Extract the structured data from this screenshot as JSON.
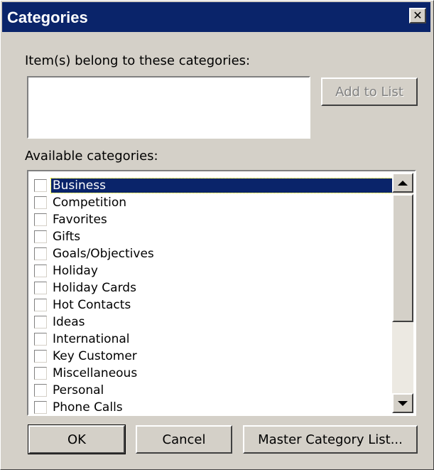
{
  "window": {
    "title": "Categories",
    "close_glyph": "✕"
  },
  "assigned": {
    "label": "Item(s) belong to these categories:",
    "value": "",
    "add_button": "Add to List"
  },
  "available": {
    "label": "Available categories:",
    "selected": "Business",
    "items": [
      {
        "label": "Business",
        "checked": false
      },
      {
        "label": "Competition",
        "checked": false
      },
      {
        "label": "Favorites",
        "checked": false
      },
      {
        "label": "Gifts",
        "checked": false
      },
      {
        "label": "Goals/Objectives",
        "checked": false
      },
      {
        "label": "Holiday",
        "checked": false
      },
      {
        "label": "Holiday Cards",
        "checked": false
      },
      {
        "label": "Hot Contacts",
        "checked": false
      },
      {
        "label": "Ideas",
        "checked": false
      },
      {
        "label": "International",
        "checked": false
      },
      {
        "label": "Key Customer",
        "checked": false
      },
      {
        "label": "Miscellaneous",
        "checked": false
      },
      {
        "label": "Personal",
        "checked": false
      },
      {
        "label": "Phone Calls",
        "checked": false
      }
    ]
  },
  "buttons": {
    "ok": "OK",
    "cancel": "Cancel",
    "master": "Master Category List..."
  },
  "colors": {
    "face": "#d4d0c8",
    "titlebar": "#0a246a",
    "selection": "#0a246a"
  },
  "icons": {
    "close": "close-icon",
    "scroll_up": "arrow-up-icon",
    "scroll_down": "arrow-down-icon",
    "checkbox": "checkbox-icon"
  }
}
